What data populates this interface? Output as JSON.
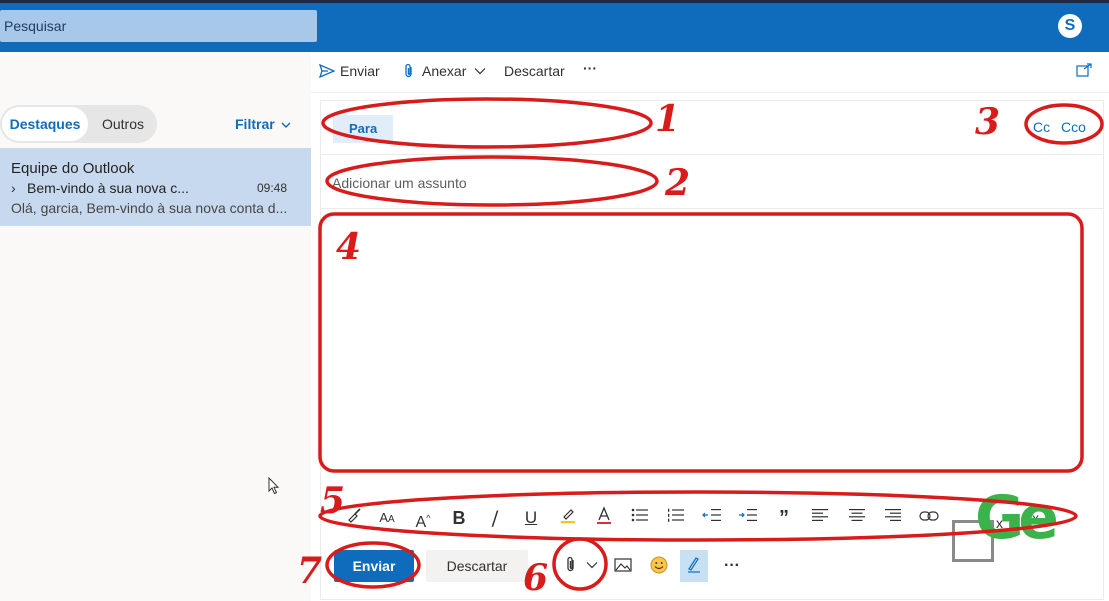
{
  "search": {
    "placeholder": "Pesquisar"
  },
  "topbar": {
    "skype_icon": "skype-icon"
  },
  "toolbar": {
    "send_label": "Enviar",
    "attach_label": "Anexar",
    "discard_label": "Descartar",
    "more_label": "···"
  },
  "pivot": {
    "focused_label": "Destaques",
    "other_label": "Outros",
    "filter_label": "Filtrar"
  },
  "messages": [
    {
      "sender": "Equipe do Outlook",
      "subject": "Bem-vindo à sua nova c...",
      "time": "09:48",
      "preview": "Olá, garcia, Bem-vindo à sua nova conta d..."
    }
  ],
  "compose": {
    "to_label": "Para",
    "cc_label": "Cc",
    "bcc_label": "Cco",
    "subject_placeholder": "Adicionar um assunto"
  },
  "format_toolbar": {
    "icons": [
      "format-painter-icon",
      "font-size-icon",
      "grow-font-icon",
      "bold-icon",
      "italic-icon",
      "underline-icon",
      "highlight-icon",
      "font-color-icon",
      "bullets-icon",
      "numbering-icon",
      "decrease-indent-icon",
      "increase-indent-icon",
      "quote-icon",
      "align-left-icon",
      "align-center-icon",
      "align-right-icon",
      "link-icon",
      "superscript-icon",
      "subscript-icon"
    ]
  },
  "actions": {
    "send_label": "Enviar",
    "discard_label": "Descartar",
    "more_label": "···"
  },
  "annotations": {
    "labels": [
      "1",
      "2",
      "3",
      "4",
      "5",
      "6",
      "7"
    ],
    "color": "#d81b1b"
  },
  "colors": {
    "brand": "#0f6cbd",
    "selected_row": "#c7d9ee",
    "logo_green": "#3bb34a"
  }
}
